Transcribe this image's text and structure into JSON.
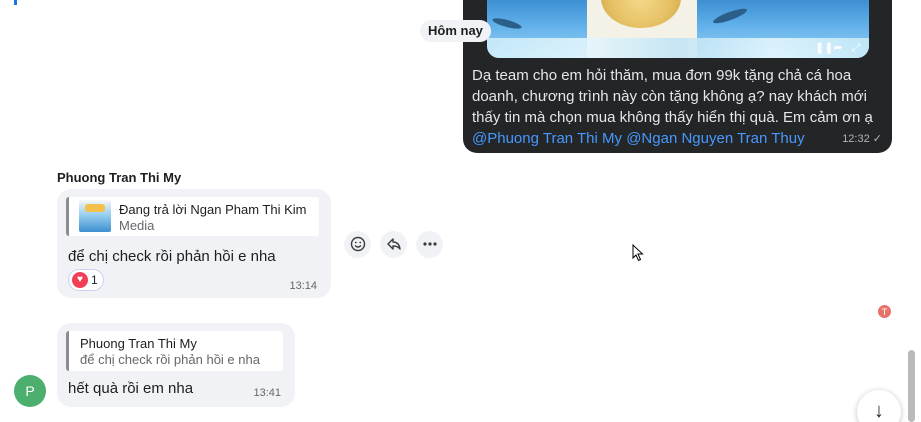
{
  "date_divider": "Hôm nay",
  "outgoing_message": {
    "text": "Dạ team cho em hỏi thăm, mua đơn 99k tặng chả cá hoa doanh, chương trình này còn tặng không ạ? nay khách mới thấy tin mà chọn mua không thấy hiển thị quà. Em cảm ơn ạ",
    "mention_1": "@Phuong Tran Thi My",
    "mention_2": "@Ngan Nguyen Tran Thuy",
    "time": "12:32"
  },
  "incoming_1": {
    "sender": "Phuong Tran Thi My",
    "reply_title": "Đang trả lời Ngan Pham Thi Kim",
    "reply_subtitle": "Media",
    "text": "để chị check rồi phản hồi e nha",
    "reaction_count": "1",
    "time": "13:14"
  },
  "incoming_2": {
    "reply_title": "Phuong Tran Thi My",
    "reply_subtitle": "để chị check rồi phản hồi e nha",
    "text": "hết quà rồi em nha",
    "time": "13:41"
  },
  "avatars": {
    "sender_initial": "P",
    "seen_initial": "T"
  },
  "colors": {
    "outgoing_bubble": "#242526",
    "incoming_bubble": "#f0f2f5",
    "mention": "#4599ff",
    "avatar_p": "#4caf6e",
    "reaction_heart": "#f33e58"
  }
}
